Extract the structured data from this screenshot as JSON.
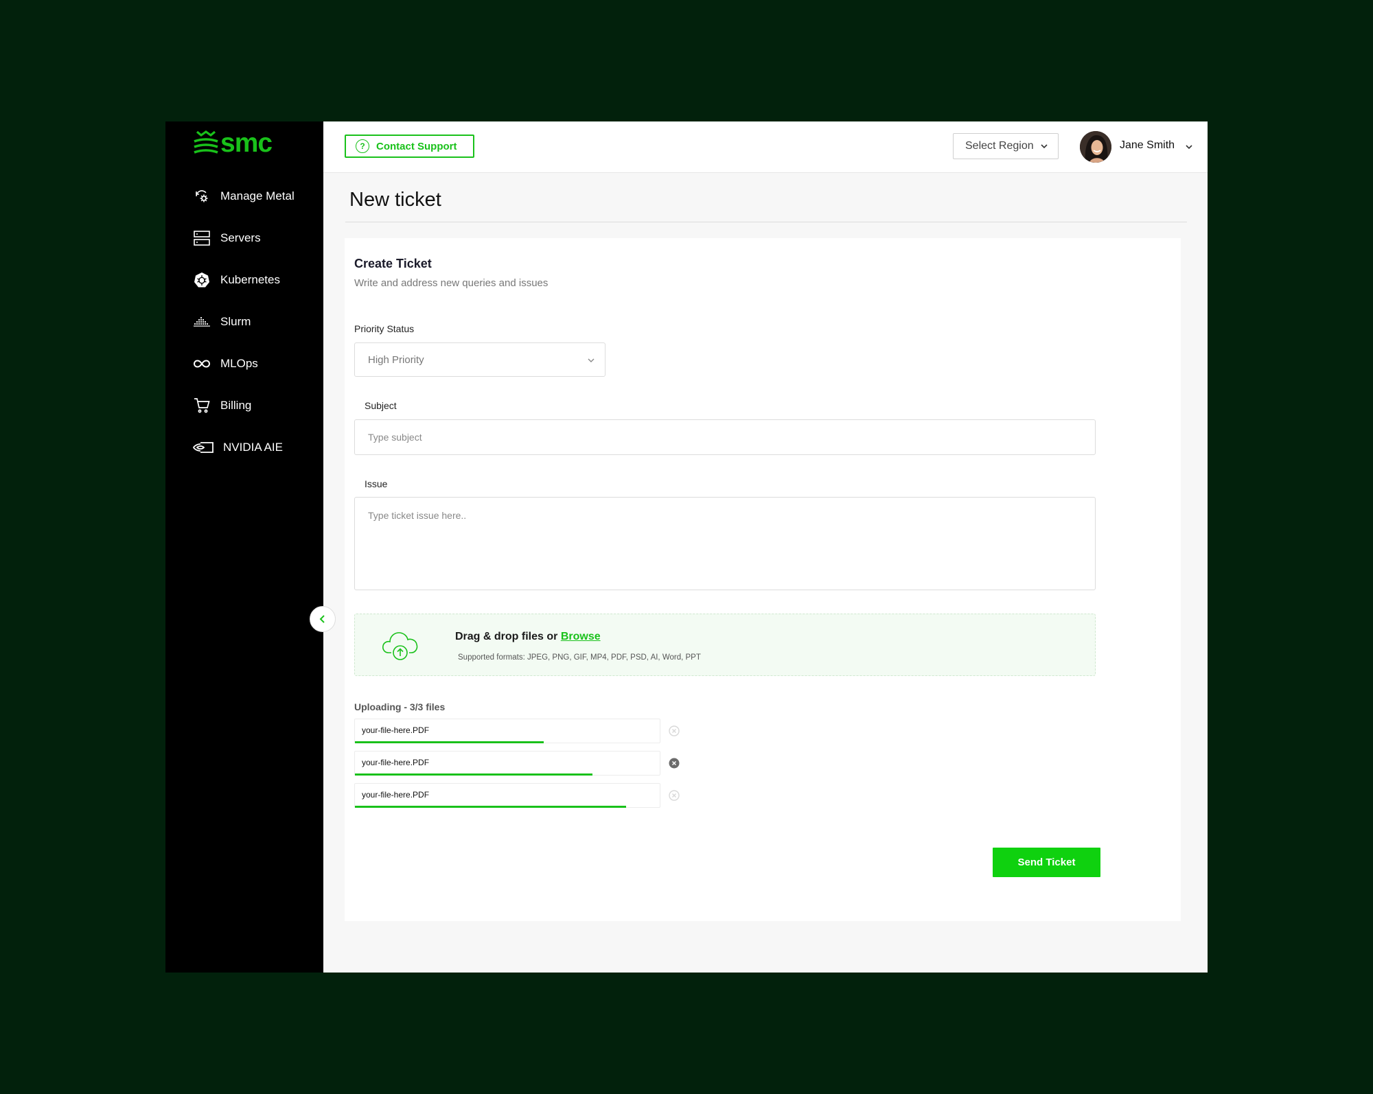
{
  "brand": {
    "name": "smc",
    "accent": "#19c11a"
  },
  "sidebar": {
    "items": [
      {
        "label": "Manage Metal",
        "icon": "metal-settings-icon"
      },
      {
        "label": "Servers",
        "icon": "server-icon"
      },
      {
        "label": "Kubernetes",
        "icon": "kubernetes-icon"
      },
      {
        "label": "Slurm",
        "icon": "slurm-icon"
      },
      {
        "label": "MLOps",
        "icon": "infinity-icon"
      },
      {
        "label": "Billing",
        "icon": "cart-icon"
      },
      {
        "label": "NVIDIA AIE",
        "icon": "nvidia-icon"
      }
    ]
  },
  "header": {
    "contact_label": "Contact Support",
    "region_label": "Select Region",
    "user_name": "Jane Smith"
  },
  "page": {
    "title": "New ticket"
  },
  "form": {
    "title": "Create Ticket",
    "subtitle": "Write and address new queries and issues",
    "priority_label": "Priority Status",
    "priority_value": "High Priority",
    "subject_label": "Subject",
    "subject_placeholder": "Type subject",
    "issue_label": "Issue",
    "issue_placeholder": "Type ticket issue here..",
    "dropzone_text": "Drag & drop files or",
    "dropzone_link": "Browse",
    "dropzone_formats": "Supported formats: JPEG, PNG, GIF, MP4, PDF, PSD, AI, Word, PPT",
    "uploading_label": "Uploading - 3/3 files",
    "files": [
      {
        "name": "your-file-here.PDF",
        "progress": 0.62
      },
      {
        "name": "your-file-here.PDF",
        "progress": 0.78
      },
      {
        "name": "your-file-here.PDF",
        "progress": 0.89
      }
    ],
    "send_label": "Send Ticket"
  }
}
